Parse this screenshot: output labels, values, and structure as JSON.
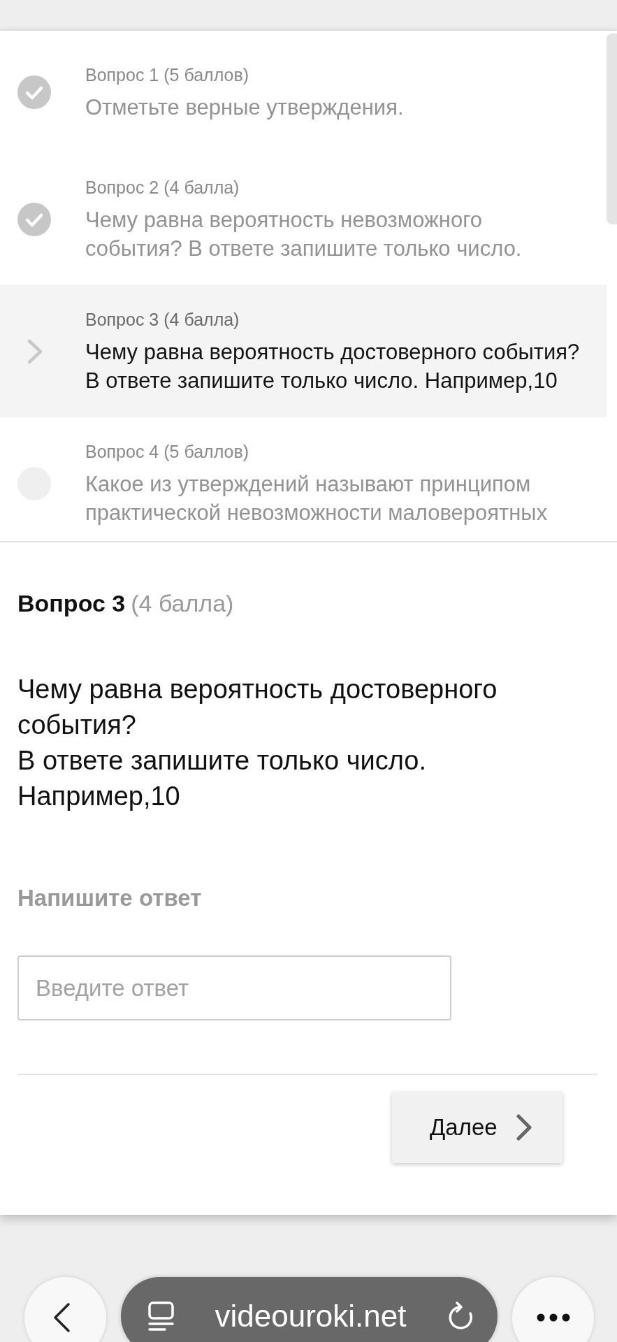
{
  "questions": [
    {
      "label": "Вопрос 1 (5 баллов)",
      "text": "Отметьте верные утверждения.",
      "kind": "answered",
      "selected": false
    },
    {
      "label": "Вопрос 2 (4 балла)",
      "text": "Чему равна вероятность невозможного события? В ответе запишите только число.",
      "kind": "answered",
      "selected": false
    },
    {
      "label": "Вопрос 3 (4 балла)",
      "text": "Чему равна вероятность достоверного события?\nВ ответе запишите только число. Например,10",
      "kind": "current",
      "selected": true
    },
    {
      "label": "Вопрос 4 (5 баллов)",
      "text": "Какое из утверждений называют принципом практической невозможности маловероятных",
      "kind": "unanswered",
      "selected": false
    }
  ],
  "current_question": {
    "title": "Вопрос 3",
    "points": "(4 балла)",
    "text": "Чему равна вероятность достоверного события?\nВ ответе запишите только число. Например,10"
  },
  "answer": {
    "label": "Напишите ответ",
    "placeholder": "Введите ответ"
  },
  "next_button": {
    "label": "Далее"
  },
  "browser_bar": {
    "url": "videouroki.net"
  }
}
